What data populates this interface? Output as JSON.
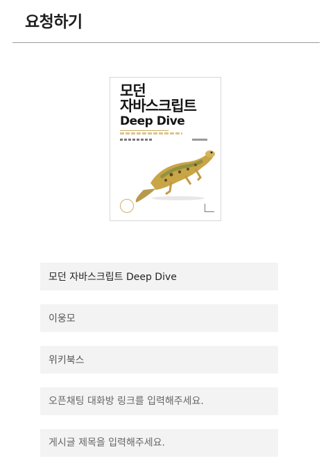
{
  "header": {
    "title": "요청하기"
  },
  "book": {
    "cover": {
      "title_ko": "모던\n자바스크립트",
      "title_en": "Deep Dive"
    }
  },
  "form": {
    "title_value": "모던 자바스크립트 Deep Dive",
    "author_value": "이웅모",
    "publisher_value": "위키북스",
    "chat_link_placeholder": "오픈채팅 대화방 링크를 입력해주세요.",
    "post_title_placeholder": "게시글 제목을 입력해주세요."
  },
  "colors": {
    "field_bg": "#f3f3f3",
    "divider": "#9a9a9a",
    "cover_accent": "#c8a85a"
  }
}
